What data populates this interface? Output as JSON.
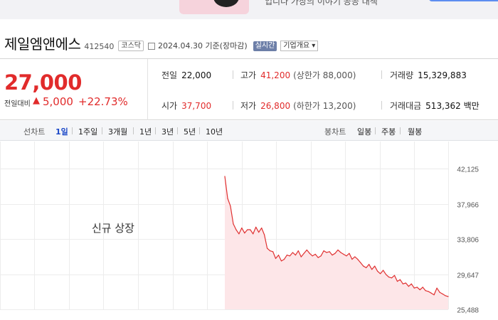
{
  "banner": {
    "text": "입니다 가장의 이야기 공공 대책"
  },
  "header": {
    "company": "제일엠앤에스",
    "code": "412540",
    "market": "코스닥",
    "as_of": "2024.04.30 기준(장마감)",
    "realtime": "실시간",
    "company_info": "기업개요 ▾"
  },
  "price": {
    "current": "27,000",
    "change_label": "전일대비",
    "arrow": "▲",
    "change": "5,000",
    "change_pct": "+22.73%"
  },
  "stats": {
    "prev_label": "전일",
    "prev_value": "22,000",
    "high_label": "고가",
    "high_value": "41,200",
    "upper_limit": "(상한가 88,000)",
    "volume_label": "거래량",
    "volume_value": "15,329,883",
    "open_label": "시가",
    "open_value": "37,700",
    "low_label": "저가",
    "low_value": "26,800",
    "lower_limit": "(하한가 13,200)",
    "amount_label": "거래대금",
    "amount_value": "513,362 백만"
  },
  "tabs": {
    "line_label": "선차트",
    "line": [
      "1일",
      "1주일",
      "3개월",
      "1년",
      "3년",
      "5년",
      "10년"
    ],
    "candle_label": "봉차트",
    "candle": [
      "일봉",
      "주봉",
      "월봉"
    ]
  },
  "colors": {
    "up": "#e12b2b",
    "line": "#e03131",
    "fill": "#fde6e8",
    "active_tab": "#1a47c7"
  },
  "chart_data": {
    "type": "area",
    "note": "신규 상장",
    "y_ticks": [
      "42,125",
      "37,966",
      "33,806",
      "29,647",
      "25,488"
    ],
    "ylim": [
      25488,
      42125
    ],
    "grid": true,
    "x": [
      0,
      1,
      2,
      3,
      4,
      5,
      6,
      7,
      8,
      9,
      10,
      11,
      12,
      13,
      14,
      15,
      16,
      17,
      18,
      19,
      20,
      21,
      22,
      23,
      24,
      25,
      26,
      27,
      28,
      29,
      30,
      31,
      32,
      33,
      34,
      35,
      36,
      37,
      38,
      39,
      40,
      41,
      42,
      43,
      44,
      45,
      46,
      47,
      48,
      49,
      50,
      51,
      52,
      53,
      54,
      55,
      56,
      57,
      58,
      59,
      60,
      61,
      62,
      63,
      64,
      65,
      66,
      67,
      68,
      69,
      70,
      71,
      72,
      73,
      74,
      75,
      76,
      77,
      78,
      79
    ],
    "values": [
      41200,
      38600,
      37700,
      35600,
      34900,
      34400,
      35100,
      34500,
      34900,
      34900,
      34400,
      35200,
      34600,
      35100,
      34300,
      32700,
      32400,
      32300,
      31500,
      31900,
      31200,
      31400,
      31900,
      31800,
      32200,
      31900,
      32400,
      31700,
      32100,
      32500,
      32100,
      31800,
      32000,
      31600,
      31800,
      32400,
      32200,
      32300,
      31900,
      32100,
      32500,
      32200,
      32000,
      31800,
      32100,
      31400,
      31700,
      31400,
      31000,
      30600,
      30400,
      30800,
      30200,
      30600,
      30000,
      29700,
      30100,
      29600,
      29300,
      29200,
      29500,
      28800,
      29000,
      28500,
      28600,
      28200,
      28500,
      28000,
      28100,
      27800,
      28100,
      27700,
      27600,
      27400,
      27200,
      28000,
      27500,
      27300,
      27100,
      27000
    ]
  }
}
